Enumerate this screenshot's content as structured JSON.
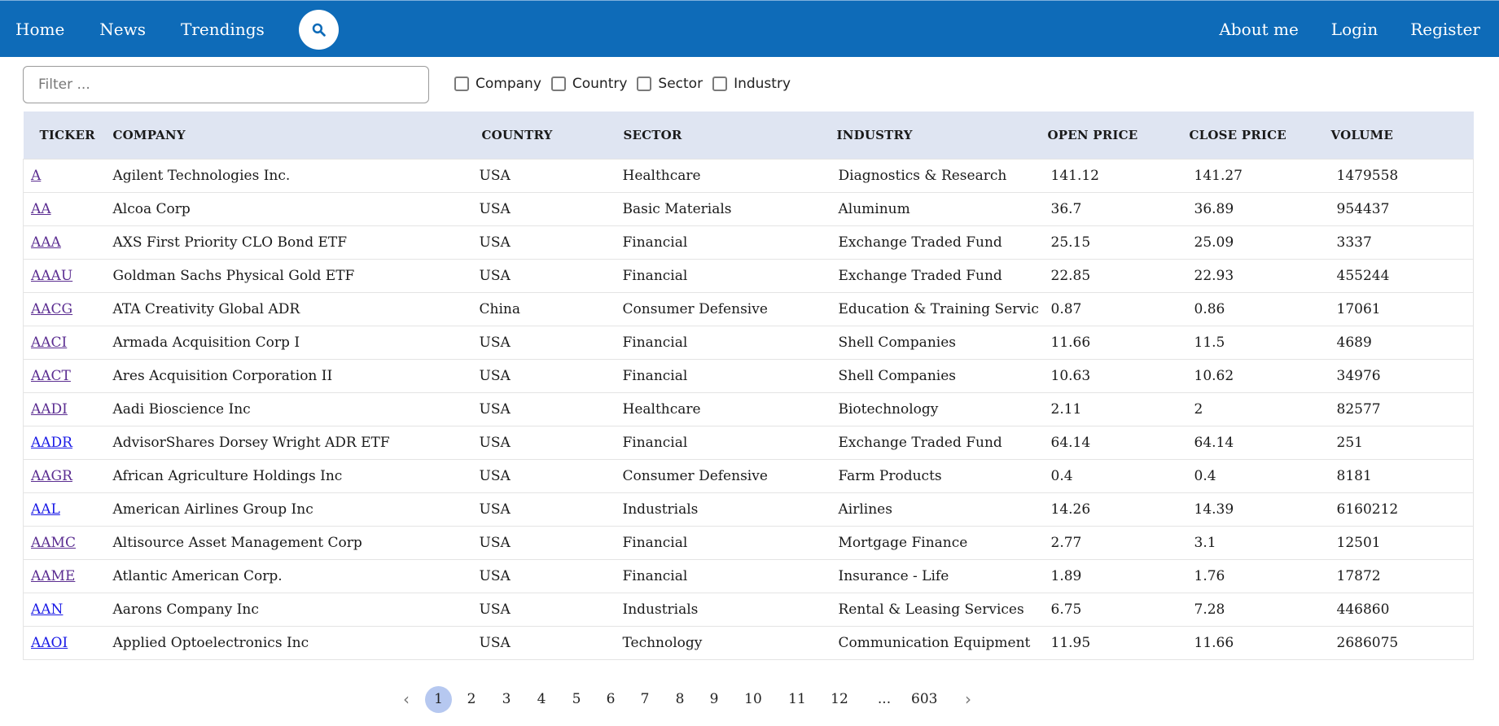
{
  "nav": {
    "home": "Home",
    "news": "News",
    "trendings": "Trendings",
    "about": "About me",
    "login": "Login",
    "register": "Register",
    "search_icon": "search-icon"
  },
  "filter": {
    "placeholder": "Filter ...",
    "checks": [
      "Company",
      "Country",
      "Sector",
      "Industry"
    ]
  },
  "table": {
    "headers": [
      "TICKER",
      "COMPANY",
      "COUNTRY",
      "SECTOR",
      "INDUSTRY",
      "OPEN PRICE",
      "CLOSE PRICE",
      "VOLUME"
    ],
    "rows": [
      [
        "A",
        "Agilent Technologies Inc.",
        "USA",
        "Healthcare",
        "Diagnostics & Research",
        "141.12",
        "141.27",
        "1479558"
      ],
      [
        "AA",
        "Alcoa Corp",
        "USA",
        "Basic Materials",
        "Aluminum",
        "36.7",
        "36.89",
        "954437"
      ],
      [
        "AAA",
        "AXS First Priority CLO Bond ETF",
        "USA",
        "Financial",
        "Exchange Traded Fund",
        "25.15",
        "25.09",
        "3337"
      ],
      [
        "AAAU",
        "Goldman Sachs Physical Gold ETF",
        "USA",
        "Financial",
        "Exchange Traded Fund",
        "22.85",
        "22.93",
        "455244"
      ],
      [
        "AACG",
        "ATA Creativity Global ADR",
        "China",
        "Consumer Defensive",
        "Education & Training Services",
        "0.87",
        "0.86",
        "17061"
      ],
      [
        "AACI",
        "Armada Acquisition Corp I",
        "USA",
        "Financial",
        "Shell Companies",
        "11.66",
        "11.5",
        "4689"
      ],
      [
        "AACT",
        "Ares Acquisition Corporation II",
        "USA",
        "Financial",
        "Shell Companies",
        "10.63",
        "10.62",
        "34976"
      ],
      [
        "AADI",
        "Aadi Bioscience Inc",
        "USA",
        "Healthcare",
        "Biotechnology",
        "2.11",
        "2",
        "82577"
      ],
      [
        "AADR",
        "AdvisorShares Dorsey Wright ADR ETF",
        "USA",
        "Financial",
        "Exchange Traded Fund",
        "64.14",
        "64.14",
        "251"
      ],
      [
        "AAGR",
        "African Agriculture Holdings Inc",
        "USA",
        "Consumer Defensive",
        "Farm Products",
        "0.4",
        "0.4",
        "8181"
      ],
      [
        "AAL",
        "American Airlines Group Inc",
        "USA",
        "Industrials",
        "Airlines",
        "14.26",
        "14.39",
        "6160212"
      ],
      [
        "AAMC",
        "Altisource Asset Management Corp",
        "USA",
        "Financial",
        "Mortgage Finance",
        "2.77",
        "3.1",
        "12501"
      ],
      [
        "AAME",
        "Atlantic American Corp.",
        "USA",
        "Financial",
        "Insurance - Life",
        "1.89",
        "1.76",
        "17872"
      ],
      [
        "AAN",
        "Aarons Company Inc",
        "USA",
        "Industrials",
        "Rental & Leasing Services",
        "6.75",
        "7.28",
        "446860"
      ],
      [
        "AAOI",
        "Applied Optoelectronics Inc",
        "USA",
        "Technology",
        "Communication Equipment",
        "11.95",
        "11.66",
        "2686075"
      ]
    ],
    "blue_links": [
      "AADR",
      "AAL",
      "AAN",
      "AAOI"
    ]
  },
  "pagination": {
    "prev": "‹",
    "next": "›",
    "pages": [
      "1",
      "2",
      "3",
      "4",
      "5",
      "6",
      "7",
      "8",
      "9",
      "10",
      "11",
      "12",
      "...",
      "603"
    ],
    "active": "1"
  }
}
